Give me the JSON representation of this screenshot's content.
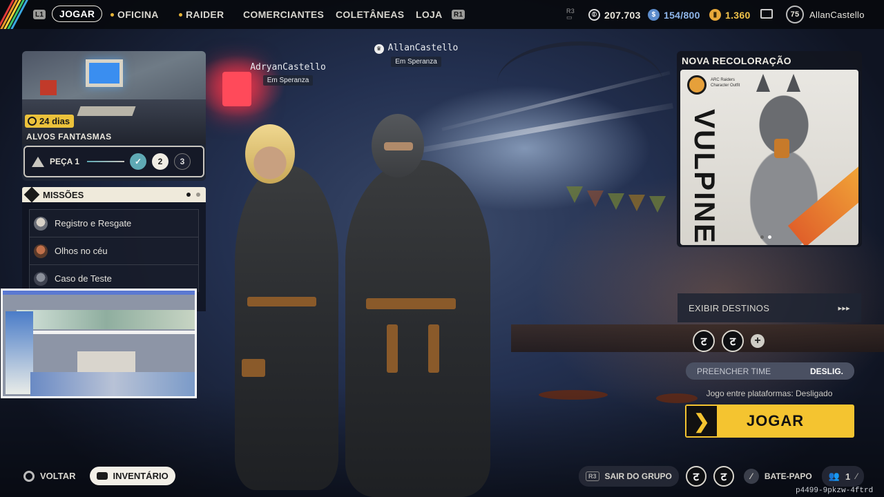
{
  "topbar": {
    "left_key": "L1",
    "right_key": "R1",
    "r3_key": "R3",
    "nav": [
      {
        "label": "JOGAR",
        "active": true,
        "dot": false
      },
      {
        "label": "OFICINA",
        "active": false,
        "dot": true
      },
      {
        "label": "RAIDER",
        "active": false,
        "dot": true
      },
      {
        "label": "COMERCIANTES",
        "active": false,
        "dot": false
      },
      {
        "label": "COLETÂNEAS",
        "active": false,
        "dot": false
      },
      {
        "label": "LOJA",
        "active": false,
        "dot": false
      }
    ],
    "coins": "207.703",
    "storage": "154/800",
    "tokens": "1.360",
    "level": "75",
    "username": "AllanCastello"
  },
  "players": [
    {
      "name": "AdryanCastello",
      "location": "Em Speranza"
    },
    {
      "name": "AllanCastello",
      "location": "Em Speranza"
    }
  ],
  "event_card": {
    "timer": "24 dias",
    "title": "ALVOS FANTASMAS",
    "progress_label": "PEÇA 1",
    "steps": [
      "2",
      "3"
    ]
  },
  "missions": {
    "title": "MISSÕES",
    "items": [
      {
        "label": "Registro e Resgate"
      },
      {
        "label": "Olhos no céu"
      },
      {
        "label": "Caso de Teste"
      }
    ]
  },
  "promo": {
    "title": "NOVA RECOLORAÇÃO",
    "brand_line1": "ARC Raiders",
    "brand_line2": "Character Outfit",
    "outfit_name": "VULPINE"
  },
  "right_panel": {
    "destinations_label": "EXIBIR DESTINOS",
    "fill_team_label": "PREENCHER TIME",
    "fill_team_value": "DESLIG.",
    "crossplay_text": "Jogo entre plataformas: Desligado",
    "play_label": "JOGAR"
  },
  "bottom": {
    "back_label": "VOLTAR",
    "inventory_label": "INVENTÁRIO",
    "leave_group_key": "R3",
    "leave_group_label": "SAIR DO GRUPO",
    "chat_label": "BATE-PAPO",
    "party_count": "1",
    "session_id": "p4499-9pkzw-4ftrd"
  },
  "colors": {
    "accent_yellow": "#f4c430",
    "timer_yellow": "#ecc23b",
    "check_teal": "#5fa9b4"
  }
}
